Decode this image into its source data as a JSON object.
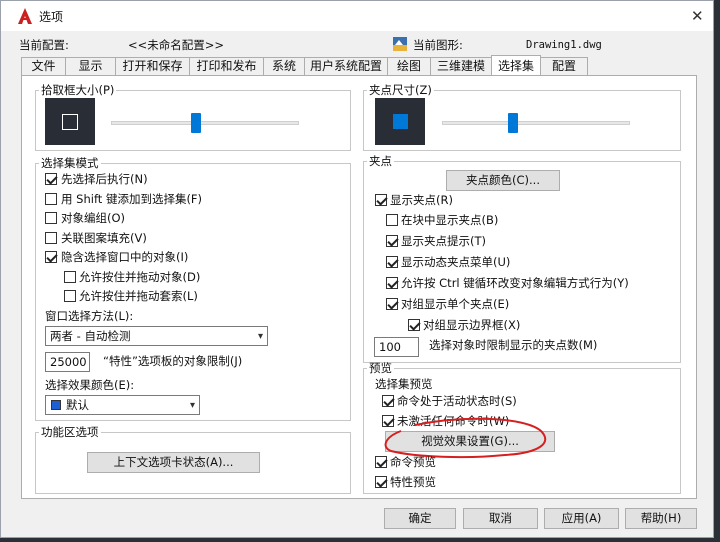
{
  "window": {
    "title": "选项",
    "close_glyph": "✕"
  },
  "header": {
    "current_profile_label": "当前配置:",
    "current_profile_value": "<<未命名配置>>",
    "current_drawing_label": "当前图形:",
    "current_drawing_value": "Drawing1.dwg"
  },
  "tabs": [
    "文件",
    "显示",
    "打开和保存",
    "打印和发布",
    "系统",
    "用户系统配置",
    "绘图",
    "三维建模",
    "选择集",
    "配置"
  ],
  "active_tab": "选择集",
  "pickbox": {
    "title": "拾取框大小(P)",
    "slider_level": 0.57
  },
  "grip_size": {
    "title": "夹点尺寸(Z)",
    "slider_level": 0.45
  },
  "selection_modes": {
    "title": "选择集模式",
    "options": [
      {
        "label": "先选择后执行(N)",
        "checked": true
      },
      {
        "label": "用 Shift 键添加到选择集(F)",
        "checked": false
      },
      {
        "label": "对象编组(O)",
        "checked": false
      },
      {
        "label": "关联图案填充(V)",
        "checked": false
      },
      {
        "label": "隐含选择窗口中的对象(I)",
        "checked": true
      },
      {
        "label": "允许按住并拖动对象(D)",
        "checked": false
      },
      {
        "label": "允许按住并拖动套索(L)",
        "checked": false
      }
    ],
    "window_method_label": "窗口选择方法(L):",
    "window_method_value": "两者 - 自动检测",
    "limit_value": "25000",
    "limit_label": "“特性”选项板的对象限制(J)",
    "effect_color_label": "选择效果颜色(E):",
    "effect_color_value": "默认",
    "effect_color_swatch": "#1f5fd6"
  },
  "ribbon": {
    "title": "功能区选项",
    "button": "上下文选项卡状态(A)..."
  },
  "grips": {
    "title": "夹点",
    "color_button": "夹点颜色(C)...",
    "options": [
      {
        "label": "显示夹点(R)",
        "checked": true
      },
      {
        "label": "在块中显示夹点(B)",
        "checked": false
      },
      {
        "label": "显示夹点提示(T)",
        "checked": true
      },
      {
        "label": "显示动态夹点菜单(U)",
        "checked": true
      },
      {
        "label": "允许按 Ctrl 键循环改变对象编辑方式行为(Y)",
        "checked": true
      },
      {
        "label": "对组显示单个夹点(E)",
        "checked": true
      },
      {
        "label": "对组显示边界框(X)",
        "checked": true
      }
    ],
    "limit_value": "100",
    "limit_label": "选择对象时限制显示的夹点数(M)"
  },
  "preview": {
    "title": "预览",
    "subtitle": "选择集预览",
    "options": [
      {
        "label": "命令处于活动状态时(S)",
        "checked": true
      },
      {
        "label": "未激活任何命令时(W)",
        "checked": true
      }
    ],
    "visual_button": "视觉效果设置(G)...",
    "cmd_preview": {
      "label": "命令预览",
      "checked": true
    },
    "prop_preview": {
      "label": "特性预览",
      "checked": true
    }
  },
  "footer": {
    "ok": "确定",
    "cancel": "取消",
    "apply": "应用(A)",
    "help": "帮助(H)"
  },
  "colors": {
    "accent": "#0078d7",
    "annotation": "#d62020",
    "preview_bg": "#292e36",
    "app_icon": "#cc1f1f"
  }
}
